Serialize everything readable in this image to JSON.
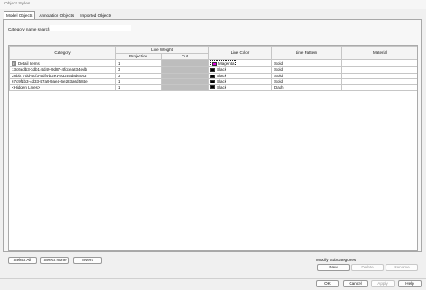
{
  "window": {
    "title": "Object Styles"
  },
  "tabs": [
    {
      "label": "Model Objects",
      "active": true
    },
    {
      "label": "Annotation Objects",
      "active": false
    },
    {
      "label": "Imported Objects",
      "active": false
    }
  ],
  "search": {
    "label": "Category name search:",
    "value": "",
    "placeholder": ""
  },
  "grid": {
    "headers": {
      "category": "Category",
      "line_weight": "Line Weight",
      "projection": "Projection",
      "cut": "Cut",
      "line_color": "Line Color",
      "line_pattern": "Line Pattern",
      "material": "Material"
    },
    "rows": [
      {
        "expander": "⊟",
        "category": "Detail Items",
        "projection": "1",
        "cut": "",
        "color_name": "Magenta",
        "color_hex": "#e000e0",
        "pattern": "Solid",
        "material": ""
      },
      {
        "category": "13c6edb3-cdb1-4d49-9d87-4fdcea834edb",
        "projection": "3",
        "cut": "",
        "color_name": "Black",
        "color_hex": "#000000",
        "pattern": "Solid",
        "material": ""
      },
      {
        "category": "28bb77dd-4cf3-4df4-b2e1-93265d8d6093",
        "projection": "3",
        "cut": "",
        "color_name": "Black",
        "color_hex": "#000000",
        "pattern": "Solid",
        "material": ""
      },
      {
        "category": "67c9f1b3-4d33-47a9-9ae4-6e283a0d584e",
        "projection": "1",
        "cut": "",
        "color_name": "Black",
        "color_hex": "#000000",
        "pattern": "Solid",
        "material": ""
      },
      {
        "category": "<Hidden Lines>",
        "projection": "1",
        "cut": "",
        "color_name": "Black",
        "color_hex": "#000000",
        "pattern": "Dash",
        "material": ""
      }
    ]
  },
  "buttons": {
    "select_all": "Select All",
    "select_none": "Select None",
    "invert": "Invert",
    "ok": "OK",
    "cancel": "Cancel",
    "apply": "Apply",
    "help": "Help"
  },
  "modify_subcategories": {
    "legend": "Modify Subcategories",
    "new": "New",
    "delete": "Delete",
    "rename": "Rename"
  }
}
